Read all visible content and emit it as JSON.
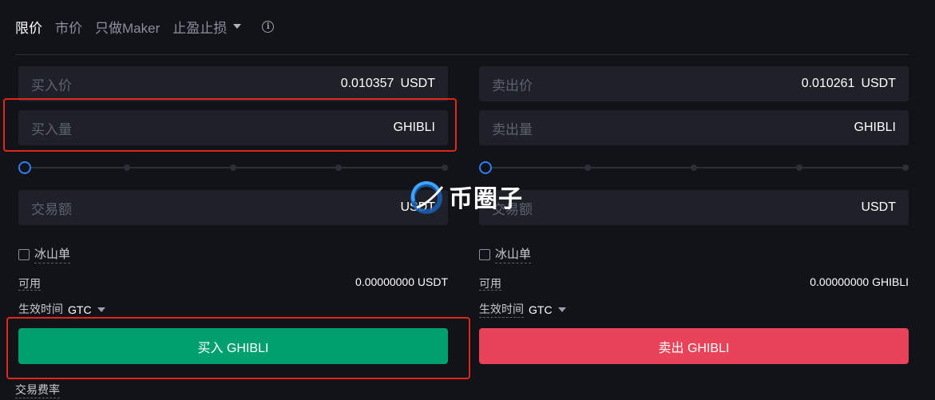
{
  "tabs": [
    {
      "label": "限价",
      "active": true
    },
    {
      "label": "市价",
      "active": false
    },
    {
      "label": "只做Maker",
      "active": false
    },
    {
      "label": "止盈止损",
      "active": false,
      "dropdown": true
    }
  ],
  "info_icon": "info-icon",
  "buy": {
    "price_label": "买入价",
    "price_value": "0.010357",
    "price_unit": "USDT",
    "amount_label": "买入量",
    "amount_unit": "GHIBLI",
    "total_label": "交易额",
    "total_unit": "USDT",
    "iceberg_label": "冰山单",
    "available_label": "可用",
    "available_value": "0.00000000 USDT",
    "tif_label": "生效时间",
    "tif_value": "GTC",
    "button_label": "买入 GHIBLI"
  },
  "sell": {
    "price_label": "卖出价",
    "price_value": "0.010261",
    "price_unit": "USDT",
    "amount_label": "卖出量",
    "amount_unit": "GHIBLI",
    "total_label": "交易额",
    "total_unit": "USDT",
    "iceberg_label": "冰山单",
    "available_label": "可用",
    "available_value": "0.00000000 GHIBLI",
    "tif_label": "生效时间",
    "tif_value": "GTC",
    "button_label": "卖出 GHIBLI"
  },
  "fee_label": "交易费率",
  "watermark": {
    "text": "币圈子"
  },
  "colors": {
    "background": "#121318",
    "field": "#1f2129",
    "buy": "#00a06e",
    "sell": "#e84359",
    "slider_knob": "#2f7ff0",
    "highlight": "#e0261d"
  }
}
